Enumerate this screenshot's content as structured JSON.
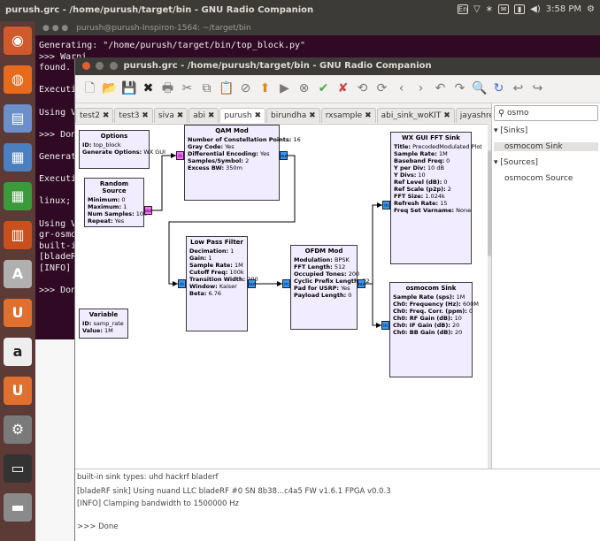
{
  "system": {
    "title": "purush.grc - /home/purush/target/bin - GNU Radio Companion",
    "clock": "3:58 PM"
  },
  "launcher": {
    "icons": [
      "ubuntu-logo-icon",
      "firefox-icon",
      "files-icon",
      "writer-icon",
      "calc-icon",
      "impress-icon",
      "font-viewer-icon",
      "ubuntu-one-icon",
      "amazon-icon",
      "ubuntu-one-music-icon",
      "system-settings-icon",
      "terminal-icon",
      "disk-icon"
    ]
  },
  "terminal": {
    "title": "purush@purush-Inspiron-1564: ~/target/bin",
    "lines": [
      "Generating: \"/home/purush/target/bin/top_block.py\"",
      ">>> Warni",
      "found. Ac",
      "",
      "Executing",
      "",
      "Using Vol",
      "",
      ">>> Done",
      "",
      "Generatin",
      "",
      "Executing",
      "",
      "linux; GN",
      "",
      "Using Vol",
      "gr-osmosc",
      "built-in",
      "[bladeRF",
      "[INFO] Cl",
      "",
      ">>> Done"
    ]
  },
  "grc": {
    "title": "purush.grc - /home/purush/target/bin - GNU Radio Companion",
    "tabs": [
      "test2 ✖",
      "test3 ✖",
      "siva ✖",
      "abi ✖",
      "purush ✖",
      "birundha ✖",
      "rxsample ✖",
      "abi_sink_woKIT ✖",
      "jayashree ✖"
    ],
    "active_tab": 4,
    "blocks": {
      "options": {
        "name": "Options",
        "params": [
          [
            "ID:",
            "top_block"
          ],
          [
            "Generate Options:",
            "WX GUI"
          ]
        ]
      },
      "random_source": {
        "name": "Random Source",
        "params": [
          [
            "Minimum:",
            "0"
          ],
          [
            "Maximum:",
            "1"
          ],
          [
            "Num Samples:",
            "10k"
          ],
          [
            "Repeat:",
            "Yes"
          ]
        ]
      },
      "variable": {
        "name": "Variable",
        "params": [
          [
            "ID:",
            "samp_rate"
          ],
          [
            "Value:",
            "1M"
          ]
        ]
      },
      "qam_mod": {
        "name": "QAM Mod",
        "params": [
          [
            "Number of Constellation Points:",
            "16"
          ],
          [
            "Gray Code:",
            "Yes"
          ],
          [
            "Differential Encoding:",
            "Yes"
          ],
          [
            "Samples/Symbol:",
            "2"
          ],
          [
            "Excess BW:",
            "350m"
          ]
        ]
      },
      "low_pass_filter": {
        "name": "Low Pass Filter",
        "params": [
          [
            "Decimation:",
            "1"
          ],
          [
            "Gain:",
            "1"
          ],
          [
            "Sample Rate:",
            "1M"
          ],
          [
            "Cutoff Freq:",
            "100k"
          ],
          [
            "Transition Width:",
            "200"
          ],
          [
            "Window:",
            "Kaiser"
          ],
          [
            "Beta:",
            "6.76"
          ]
        ]
      },
      "ofdm_mod": {
        "name": "OFDM Mod",
        "params": [
          [
            "Modulation:",
            "BPSK"
          ],
          [
            "FFT Length:",
            "512"
          ],
          [
            "Occupied Tones:",
            "200"
          ],
          [
            "Cyclic Prefix Length:",
            "32"
          ],
          [
            "Pad for USRP:",
            "Yes"
          ],
          [
            "Payload Length:",
            "0"
          ]
        ]
      },
      "wx_fft_sink": {
        "name": "WX GUI FFT Sink",
        "params": [
          [
            "Title:",
            "PrecodedModulated Plot"
          ],
          [
            "Sample Rate:",
            "1M"
          ],
          [
            "Baseband Freq:",
            "0"
          ],
          [
            "Y per Div:",
            "10 dB"
          ],
          [
            "Y Divs:",
            "10"
          ],
          [
            "Ref Level (dB):",
            "0"
          ],
          [
            "Ref Scale (p2p):",
            "2"
          ],
          [
            "FFT Size:",
            "1.024k"
          ],
          [
            "Refresh Rate:",
            "15"
          ],
          [
            "Freq Set Varname:",
            "None"
          ]
        ]
      },
      "osmocom_sink": {
        "name": "osmocom Sink",
        "params": [
          [
            "Sample Rate (sps):",
            "1M"
          ],
          [
            "Ch0: Frequency (Hz):",
            "600M"
          ],
          [
            "Ch0: Freq. Corr. (ppm):",
            "0"
          ],
          [
            "Ch0: RF Gain (dB):",
            "10"
          ],
          [
            "Ch0: IF Gain (dB):",
            "20"
          ],
          [
            "Ch0: BB Gain (dB):",
            "20"
          ]
        ]
      }
    },
    "port_labels": {
      "out": "out",
      "in": "in"
    },
    "search_value": "osmo",
    "tree": [
      {
        "label": "[Sinks]",
        "indent": 0,
        "selected": false
      },
      {
        "label": "osmocom Sink",
        "indent": 1,
        "selected": true
      },
      {
        "label": "[Sources]",
        "indent": 0,
        "selected": false
      },
      {
        "label": "osmocom Source",
        "indent": 1,
        "selected": false
      }
    ],
    "console": [
      "built-in sink types: uhd hackrf bladerf",
      "[bladeRF sink] Using nuand LLC bladeRF #0 SN 8b38...c4a5 FW v1.6.1 FPGA v0.0.3",
      "[INFO] Clamping bandwidth to 1500000 Hz",
      ">>> Done"
    ]
  },
  "colors": {
    "block_fill": "#f1ecff",
    "complex_port": "#3399ff",
    "float_port": "#ff66ff",
    "terminal_bg": "#300a24",
    "launcher_bg": "#5c3a35"
  }
}
